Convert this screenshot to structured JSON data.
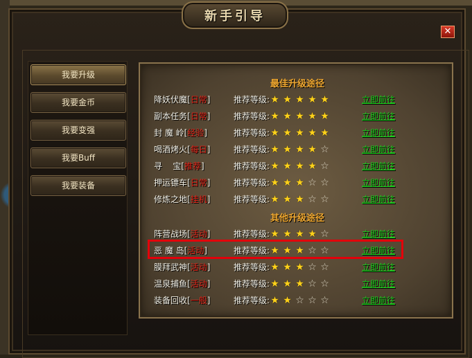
{
  "window": {
    "title": "新手引导",
    "close_label": "✕"
  },
  "menu": {
    "items": [
      {
        "label": "我要升级",
        "active": true
      },
      {
        "label": "我要金币"
      },
      {
        "label": "我要变强"
      },
      {
        "label": "我要Buff"
      },
      {
        "label": "我要装备"
      }
    ]
  },
  "main": {
    "section1_title": "最佳升级途径",
    "section2_title": "其他升级途径",
    "level_label": "推荐等级:",
    "go_label": "立即前往",
    "best_rows": [
      {
        "name": "降妖伏魔",
        "tag": "日常",
        "stars": 5
      },
      {
        "name": "副本任务",
        "tag": "日常",
        "stars": 5
      },
      {
        "name": "封 魔 岭",
        "tag": "经验",
        "stars": 5
      },
      {
        "name": "喝酒烤火",
        "tag": "每日",
        "stars": 4
      },
      {
        "name": "寻    宝",
        "tag": "推荐",
        "stars": 4
      },
      {
        "name": "押运镖车",
        "tag": "日常",
        "stars": 3
      },
      {
        "name": "修炼之地",
        "tag": "挂机",
        "stars": 3
      }
    ],
    "other_rows": [
      {
        "name": "阵营战场",
        "tag": "活动",
        "stars": 4
      },
      {
        "name": "恶 魔 岛",
        "tag": "活动",
        "stars": 3
      },
      {
        "name": "膜拜武神",
        "tag": "活动",
        "stars": 3
      },
      {
        "name": "温泉捕鱼",
        "tag": "活动",
        "stars": 3
      },
      {
        "name": "装备回收",
        "tag": "一般",
        "stars": 2
      }
    ]
  },
  "colors": {
    "tag_red": "#e02418",
    "link_green": "#1ed41e",
    "section_orange": "#f0a830",
    "star_gold": "#ffd21a",
    "highlight_red": "#e3000a"
  }
}
